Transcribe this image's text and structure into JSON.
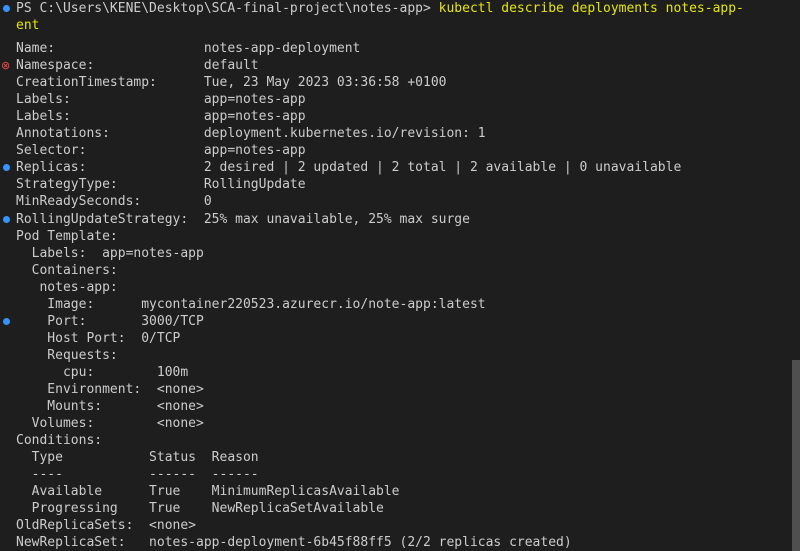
{
  "terminal": {
    "prompt": "PS C:\\Users\\KENE\\Desktop\\SCA-final-project\\notes-app> ",
    "command": "kubectl describe deployments notes-app-",
    "command_wrap": "ent",
    "lines": [
      "Name:                   notes-app-deployment",
      "Namespace:              default",
      "CreationTimestamp:      Tue, 23 May 2023 03:36:58 +0100",
      "Labels:                 app=notes-app",
      "Labels:                 app=notes-app",
      "Annotations:            deployment.kubernetes.io/revision: 1",
      "Selector:               app=notes-app",
      "Replicas:               2 desired | 2 updated | 2 total | 2 available | 0 unavailable",
      "StrategyType:           RollingUpdate",
      "MinReadySeconds:        0",
      "RollingUpdateStrategy:  25% max unavailable, 25% max surge",
      "Pod Template:",
      "  Labels:  app=notes-app",
      "  Containers:",
      "   notes-app:",
      "    Image:      mycontainer220523.azurecr.io/note-app:latest",
      "    Port:       3000/TCP",
      "    Host Port:  0/TCP",
      "    Requests:",
      "      cpu:        100m",
      "    Environment:  <none>",
      "    Mounts:       <none>",
      "  Volumes:        <none>",
      "Conditions:",
      "  Type           Status  Reason",
      "  ----           ------  ------",
      "  Available      True    MinimumReplicasAvailable",
      "  Progressing    True    NewReplicaSetAvailable",
      "OldReplicaSets:  <none>",
      "NewReplicaSet:   notes-app-deployment-6b45f88ff5 (2/2 replicas created)"
    ],
    "markers": {
      "command": "info",
      "lines": {
        "1": "error",
        "7": "info",
        "10": "info",
        "16": "info"
      }
    },
    "error_glyph": "⊗",
    "colors": {
      "background": "#1e1e1e",
      "foreground": "#cccccc",
      "command": "#e5e510",
      "info_marker": "#3794ff",
      "error_marker": "#f14c4c"
    }
  }
}
